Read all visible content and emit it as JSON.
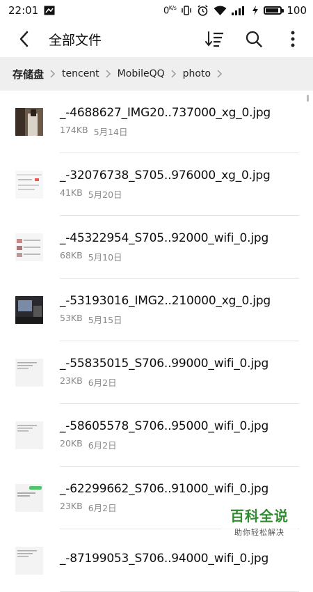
{
  "status": {
    "time": "22:01",
    "net_speed": "0",
    "net_speed_unit": "K/s",
    "battery": "100",
    "battery_level": 1.0
  },
  "header": {
    "title": "全部文件"
  },
  "breadcrumb": [
    "存储盘",
    "tencent",
    "MobileQQ",
    "photo"
  ],
  "files": [
    {
      "name": "_-4688627_IMG20..737000_xg_0.jpg",
      "size": "174KB",
      "date": "5月14日",
      "thumb": "photo-dark"
    },
    {
      "name": "_-32076738_S705..976000_xg_0.jpg",
      "size": "41KB",
      "date": "5月20日",
      "thumb": "screenshot"
    },
    {
      "name": "_-45322954_S705..92000_wifi_0.jpg",
      "size": "68KB",
      "date": "5月10日",
      "thumb": "screenshot-list"
    },
    {
      "name": "_-53193016_IMG2..210000_xg_0.jpg",
      "size": "53KB",
      "date": "5月15日",
      "thumb": "photo-monitor"
    },
    {
      "name": "_-55835015_S706..99000_wifi_0.jpg",
      "size": "23KB",
      "date": "6月2日",
      "thumb": "text-light"
    },
    {
      "name": "_-58605578_S706..95000_wifi_0.jpg",
      "size": "20KB",
      "date": "6月2日",
      "thumb": "text-light"
    },
    {
      "name": "_-62299662_S706..91000_wifi_0.jpg",
      "size": "23KB",
      "date": "6月2日",
      "thumb": "chat-green"
    },
    {
      "name": "_-87199053_S706..94000_wifi_0.jpg",
      "size": "",
      "date": "",
      "thumb": "text-light"
    }
  ],
  "watermark": {
    "main": "百科全说",
    "sub": "助你轻松解决"
  }
}
